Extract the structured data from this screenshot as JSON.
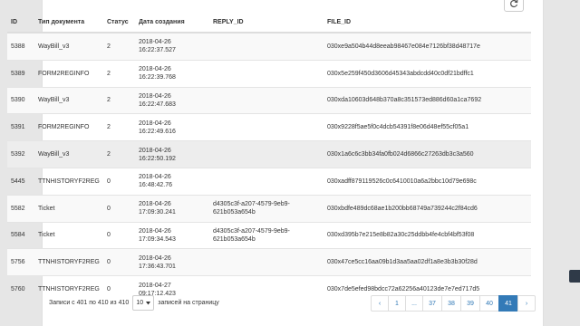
{
  "table": {
    "headers": [
      "ID",
      "Тип документа",
      "Статус",
      "Дата создания",
      "REPLY_ID",
      "FILE_ID"
    ],
    "rows": [
      {
        "id": "5388",
        "type": "WayBill_v3",
        "status": "2",
        "date": "2018-04-26",
        "time": "16:22:37.527",
        "reply1": "",
        "reply2": "",
        "file": "030xe9a504b44d8eeab98467e084e7126bf38d48717e"
      },
      {
        "id": "5389",
        "type": "FORM2REGINFO",
        "status": "2",
        "date": "2018-04-26",
        "time": "16:22:39.768",
        "reply1": "",
        "reply2": "",
        "file": "030x5e259f450d3606d45343abdcdd40c0df21bdffc1"
      },
      {
        "id": "5390",
        "type": "WayBill_v3",
        "status": "2",
        "date": "2018-04-26",
        "time": "16:22:47.683",
        "reply1": "",
        "reply2": "",
        "file": "030xda10603d648b370a8c351573ed886d60a1ca7692"
      },
      {
        "id": "5391",
        "type": "FORM2REGINFO",
        "status": "2",
        "date": "2018-04-26",
        "time": "16:22:49.616",
        "reply1": "",
        "reply2": "",
        "file": "030x9228f5ae5f0c4dcb54391f8e06d48ef55cf05a1"
      },
      {
        "id": "5392",
        "type": "WayBill_v3",
        "status": "2",
        "date": "2018-04-26",
        "time": "16:22:50.192",
        "reply1": "",
        "reply2": "",
        "file": "030x1a6c6c3bb34fa0fb024d6866c27263db3c3a560"
      },
      {
        "id": "5445",
        "type": "TTNHISTORYF2REG",
        "status": "0",
        "date": "2018-04-26",
        "time": "16:48:42.76",
        "reply1": "",
        "reply2": "",
        "file": "030xadff879119526c0c6410010a6a2bbc10d79e698c"
      },
      {
        "id": "5582",
        "type": "Ticket",
        "status": "0",
        "date": "2018-04-26",
        "time": "17:09:30.241",
        "reply1": "d4305c3f-a207-4579-9eb9-",
        "reply2": "621b053a654b",
        "file": "030xbdfe489dc68ae1b200bb68749a739244c2f84cd6"
      },
      {
        "id": "5584",
        "type": "Ticket",
        "status": "0",
        "date": "2018-04-26",
        "time": "17:09:34.543",
        "reply1": "d4305c3f-a207-4579-9eb9-",
        "reply2": "621b053a654b",
        "file": "030xd395b7e215e8b82a30c25ddbb4fe4cbf4bf53f08"
      },
      {
        "id": "5756",
        "type": "TTNHISTORYF2REG",
        "status": "0",
        "date": "2018-04-26",
        "time": "17:36:43.701",
        "reply1": "",
        "reply2": "",
        "file": "030x47ce5cc16aa09b1d3aa5aa02df1a8e3b3b30f28d"
      },
      {
        "id": "5760",
        "type": "TTNHISTORYF2REG",
        "status": "0",
        "date": "2018-04-27",
        "time": "09:17:12.423",
        "reply1": "",
        "reply2": "",
        "file": "030x7de5efed98bdcc72a62256a40123de7e7ed717d5"
      }
    ]
  },
  "footer": {
    "info": "Записи с 401 по 410 из 410",
    "page_size": "10",
    "page_size_suffix": "записей на страницу"
  },
  "pagination": [
    "‹",
    "1",
    "...",
    "37",
    "38",
    "39",
    "40",
    "41",
    "›"
  ],
  "pagination_active": "41",
  "icons": {
    "refresh": "refresh-icon",
    "select": "caret-down-icon"
  },
  "colors": {
    "accent": "#337ab7",
    "background": "#e6e6e6"
  }
}
